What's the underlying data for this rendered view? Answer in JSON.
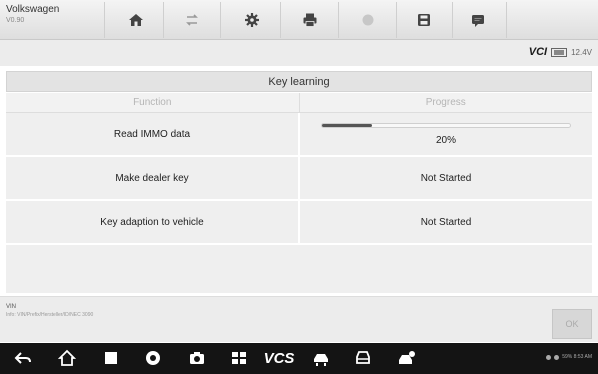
{
  "app": {
    "brand": "Volkswagen",
    "version": "V0.90"
  },
  "toolbar": {
    "icons": [
      "home-icon",
      "vehicle-swap-icon",
      "settings-icon",
      "print-icon",
      "help-icon",
      "save-icon",
      "messages-icon"
    ]
  },
  "status": {
    "vcb_label": "VCI",
    "voltage": "12.4V"
  },
  "page": {
    "title": "Key learning"
  },
  "table": {
    "headers": [
      "Function",
      "Progress"
    ],
    "rows": [
      {
        "function": "Read IMMO data",
        "progress_text": "20%",
        "progress_value": 0.2
      },
      {
        "function": "Make dealer key",
        "progress_text": "Not Started"
      },
      {
        "function": "Key adaption to vehicle",
        "progress_text": "Not Started"
      }
    ]
  },
  "footer": {
    "vin_label": "VIN",
    "vin_detail": "Info: VIN/Prefix/Hersteller/ID/NEC 3090",
    "ok_label": "OK"
  },
  "navbar": {
    "vcs_label": "VCS",
    "system_status": "59% 8:53 AM"
  },
  "colors": {
    "progress_fill": "#555555",
    "nav_bg": "#141414",
    "row_bg": "#efefef"
  }
}
